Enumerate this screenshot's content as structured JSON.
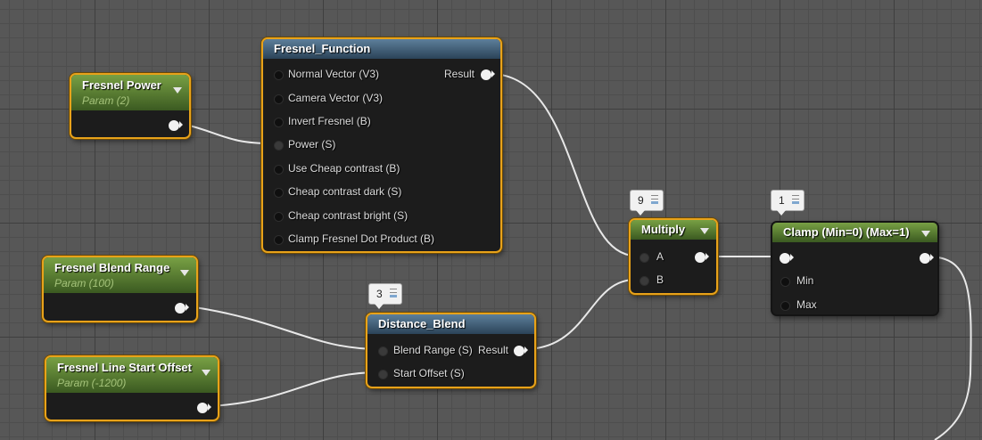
{
  "nodes": {
    "fresnel_power": {
      "title": "Fresnel Power",
      "subtitle": "Param (2)"
    },
    "fresnel_function": {
      "title": "Fresnel_Function",
      "output": "Result",
      "inputs": [
        "Normal Vector (V3)",
        "Camera Vector (V3)",
        "Invert Fresnel (B)",
        "Power (S)",
        "Use Cheap contrast (B)",
        "Cheap contrast dark (S)",
        "Cheap contrast bright (S)",
        "Clamp Fresnel Dot Product (B)"
      ]
    },
    "fresnel_blend_range": {
      "title": "Fresnel Blend Range",
      "subtitle": "Param (100)"
    },
    "fresnel_line_start_offset": {
      "title": "Fresnel Line Start Offset",
      "subtitle": "Param (-1200)"
    },
    "distance_blend": {
      "title": "Distance_Blend",
      "badge": "3",
      "inputs": [
        "Blend Range (S)",
        "Start Offset (S)"
      ],
      "output": "Result"
    },
    "multiply": {
      "title": "Multiply",
      "badge": "9",
      "inputs": [
        "A",
        "B"
      ]
    },
    "clamp": {
      "title": "Clamp (Min=0) (Max=1)",
      "badge": "1",
      "inputs": [
        "Min",
        "Max"
      ]
    }
  },
  "colors": {
    "selected_border": "#e8a21a",
    "param_header": "#5a7e33",
    "function_header": "#3d5b75",
    "node_body": "#1c1c1c",
    "wire": "#ececec",
    "grid_bg": "#575757"
  },
  "icons": [
    "dropdown-arrow-icon",
    "expand-arrows-icon",
    "stats-icon"
  ]
}
